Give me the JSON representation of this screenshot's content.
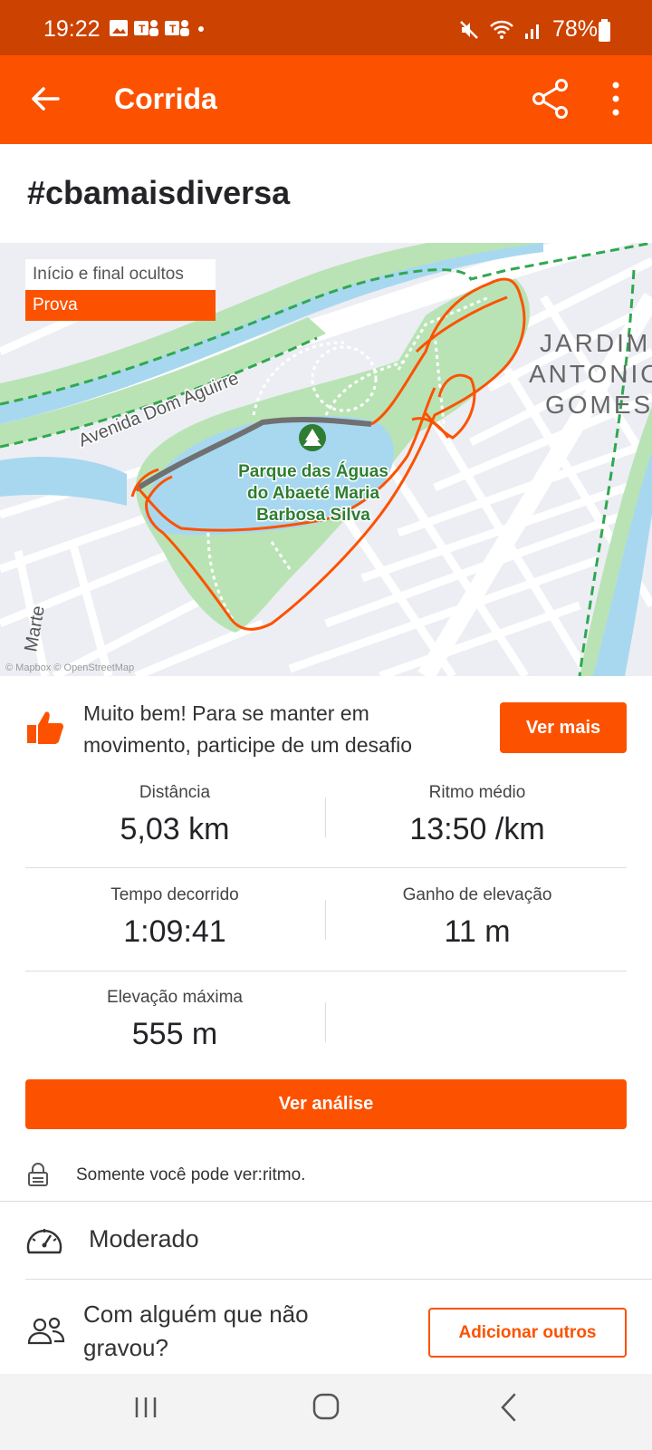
{
  "status_bar": {
    "time": "19:22",
    "battery": "78%"
  },
  "app_bar": {
    "title": "Corrida"
  },
  "activity": {
    "title": "#cbamaisdiversa"
  },
  "map": {
    "hidden_label": "Início e final ocultos",
    "race_label": "Prova",
    "street_label": "Avenida Dom Aguirre",
    "park_label_line1": "Parque das Águas",
    "park_label_line2": "do Abaeté Maria",
    "park_label_line3": "Barbosa Silva",
    "district_line1": "JARDIM",
    "district_line2": "ANTONIO",
    "district_line3": "GOMES",
    "side_street": "Marte",
    "attribution": "© Mapbox © OpenStreetMap",
    "route_color": "#fc5200"
  },
  "kudos": {
    "line1": "Muito bem! Para se manter em",
    "line2": "movimento, participe de um desafio",
    "button": "Ver mais"
  },
  "stats": [
    {
      "label": "Distância",
      "value": "5,03 km"
    },
    {
      "label": "Ritmo médio",
      "value": "13:50 /km"
    },
    {
      "label": "Tempo decorrido",
      "value": "1:09:41"
    },
    {
      "label": "Ganho de elevação",
      "value": "11 m"
    },
    {
      "label": "Elevação máxima",
      "value": "555 m"
    }
  ],
  "analysis_button": "Ver análise",
  "privacy": "Somente você pode ver:ritmo.",
  "effort": "Moderado",
  "group": {
    "line1": "Com alguém que não",
    "line2": "gravou?",
    "button": "Adicionar outros"
  },
  "theme": {
    "accent": "#fc5200",
    "status_bar": "#cc4200"
  }
}
